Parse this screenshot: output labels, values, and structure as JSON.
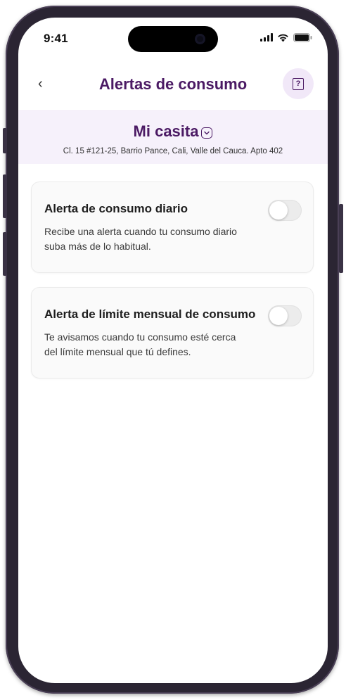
{
  "status_bar": {
    "time": "9:41",
    "icons": [
      "cellular-signal-icon",
      "wifi-icon",
      "battery-icon"
    ]
  },
  "nav": {
    "back_glyph": "‹",
    "title": "Alertas de consumo",
    "help_glyph": "?"
  },
  "location": {
    "name": "Mi casita",
    "address": "Cl. 15 #121-25, Barrio Pance, Cali, Valle del Cauca. Apto 402"
  },
  "alerts": [
    {
      "title": "Alerta de consumo diario",
      "description": "Recibe una alerta cuando tu consumo diario suba más de lo habitual.",
      "enabled": false
    },
    {
      "title": "Alerta de límite mensual de consumo",
      "description": "Te avisamos cuando tu consumo esté cerca del límite mensual que tú defines.",
      "enabled": false
    }
  ],
  "colors": {
    "brand": "#4b1a64",
    "band_bg": "#f6f1fb",
    "help_bg": "#f1e8f8",
    "frame": "#2b2533"
  }
}
